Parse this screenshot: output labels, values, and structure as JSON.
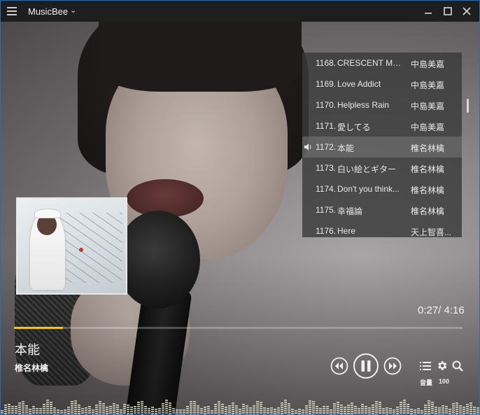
{
  "app": {
    "title": "MusicBee"
  },
  "window_controls": [
    "minimize-icon",
    "maximize-icon",
    "close-icon"
  ],
  "playlist": [
    {
      "num": "1168.",
      "title": "CRESCENT MO...",
      "artist": "中島美嘉",
      "playing": false
    },
    {
      "num": "1169.",
      "title": "Love Addict",
      "artist": "中島美嘉",
      "playing": false
    },
    {
      "num": "1170.",
      "title": "Helpless Rain",
      "artist": "中島美嘉",
      "playing": false
    },
    {
      "num": "1171.",
      "title": "愛してる",
      "artist": "中島美嘉",
      "playing": false
    },
    {
      "num": "1172.",
      "title": "本能",
      "artist": "椎名林檎",
      "playing": true
    },
    {
      "num": "1173.",
      "title": "白い絵とギター",
      "artist": "椎名林檎",
      "playing": false
    },
    {
      "num": "1174.",
      "title": "Don't you think...",
      "artist": "椎名林檎",
      "playing": false
    },
    {
      "num": "1175.",
      "title": "幸福論",
      "artist": "椎名林檎",
      "playing": false
    },
    {
      "num": "1176.",
      "title": "Here",
      "artist": "天上智喜...",
      "playing": false
    }
  ],
  "now_playing": {
    "title": "本能",
    "artist": "椎名林檎",
    "time": "0:27/ 4:16",
    "progress": 0.109
  },
  "volume": {
    "label": "音量",
    "value": "100"
  },
  "colors": {
    "accent": "#f5c518",
    "titlebar": "#1e1e1e",
    "window_border": "#2c6fb0"
  }
}
